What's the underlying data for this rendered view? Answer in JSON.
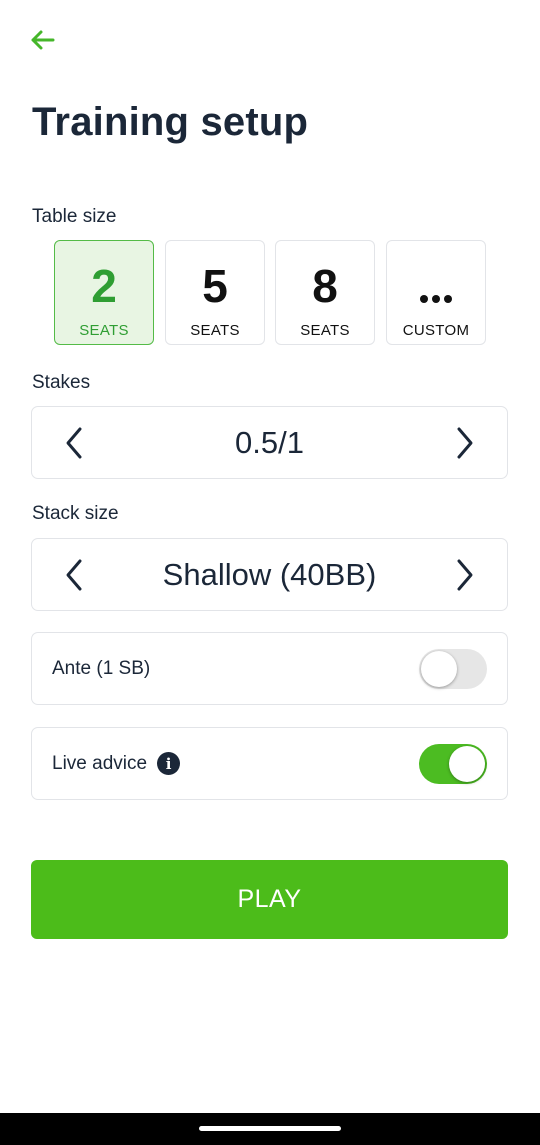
{
  "header": {
    "back_icon": "arrow-left-icon",
    "title": "Training setup"
  },
  "colors": {
    "accent": "#4cbc1a",
    "selected_border": "#54bb47",
    "selected_bg": "#e8f5e3",
    "text_dark": "#1b2738"
  },
  "table_size": {
    "label": "Table size",
    "options": [
      {
        "value": "2",
        "sub": "SEATS",
        "selected": true
      },
      {
        "value": "5",
        "sub": "SEATS",
        "selected": false
      },
      {
        "value": "8",
        "sub": "SEATS",
        "selected": false
      },
      {
        "value": "",
        "sub": "CUSTOM",
        "icon": "ellipsis-icon",
        "selected": false
      }
    ]
  },
  "stakes": {
    "label": "Stakes",
    "value": "0.5/1"
  },
  "stack_size": {
    "label": "Stack size",
    "value": "Shallow (40BB)"
  },
  "ante": {
    "label": "Ante (1 SB)",
    "enabled": false
  },
  "live_advice": {
    "label": "Live advice",
    "info_icon": "info-icon",
    "enabled": true
  },
  "play_button": {
    "label": "PLAY"
  }
}
